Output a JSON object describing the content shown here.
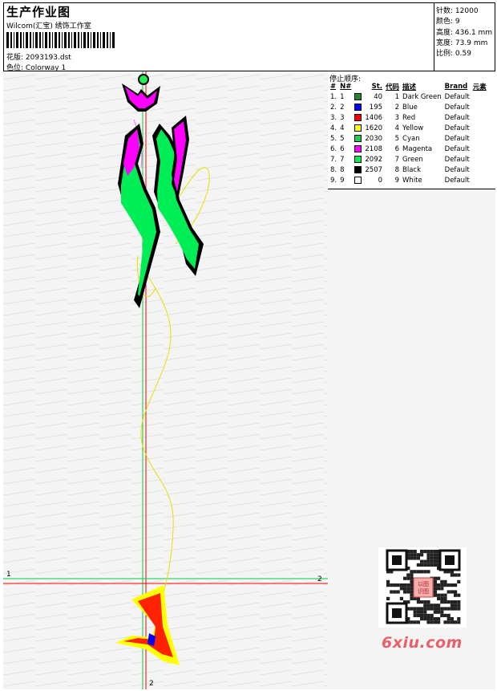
{
  "header": {
    "title": "生产作业图",
    "company": "Wilcom(汇宝) 绣饰工作室",
    "design_label": "花版:",
    "design_value": "2093193.dst",
    "colorway_label": "色位:",
    "colorway_value": "Colorway 1"
  },
  "stats": [
    {
      "label": "针数:",
      "value": "12000"
    },
    {
      "label": "颜色:",
      "value": "9"
    },
    {
      "label": "高度:",
      "value": "436.1 mm"
    },
    {
      "label": "宽度:",
      "value": "73.9 mm"
    },
    {
      "label": "比例:",
      "value": "0.59"
    }
  ],
  "stop_sequence": {
    "title": "停止顺序:",
    "columns": [
      "#",
      "N#",
      "St.",
      "代码",
      "描述",
      "Brand",
      "元素"
    ],
    "rows": [
      {
        "idx": "1.",
        "n": "1",
        "color": "#1a8a2a",
        "st": "40",
        "code": "1",
        "desc": "Dark Green",
        "brand": "Default"
      },
      {
        "idx": "2.",
        "n": "2",
        "color": "#0000ff",
        "st": "195",
        "code": "2",
        "desc": "Blue",
        "brand": "Default"
      },
      {
        "idx": "3.",
        "n": "3",
        "color": "#ff0000",
        "st": "1406",
        "code": "3",
        "desc": "Red",
        "brand": "Default"
      },
      {
        "idx": "4.",
        "n": "4",
        "color": "#ffff00",
        "st": "1620",
        "code": "4",
        "desc": "Yellow",
        "brand": "Default"
      },
      {
        "idx": "5.",
        "n": "5",
        "color": "#22cc55",
        "st": "2030",
        "code": "5",
        "desc": "Cyan",
        "brand": "Default"
      },
      {
        "idx": "6.",
        "n": "6",
        "color": "#ff00ff",
        "st": "2108",
        "code": "6",
        "desc": "Magenta",
        "brand": "Default"
      },
      {
        "idx": "7.",
        "n": "7",
        "color": "#00ee55",
        "st": "2092",
        "code": "7",
        "desc": "Green",
        "brand": "Default"
      },
      {
        "idx": "8.",
        "n": "8",
        "color": "#000000",
        "st": "2507",
        "code": "8",
        "desc": "Black",
        "brand": "Default"
      },
      {
        "idx": "9.",
        "n": "9",
        "color": "#ffffff",
        "st": "0",
        "code": "9",
        "desc": "White",
        "brand": "Default"
      }
    ]
  },
  "axis_labels": {
    "h_left": "1",
    "h_right": "2",
    "v_bottom": "2"
  },
  "watermark": "6xiu.com",
  "qr_stamp": "以图识图"
}
